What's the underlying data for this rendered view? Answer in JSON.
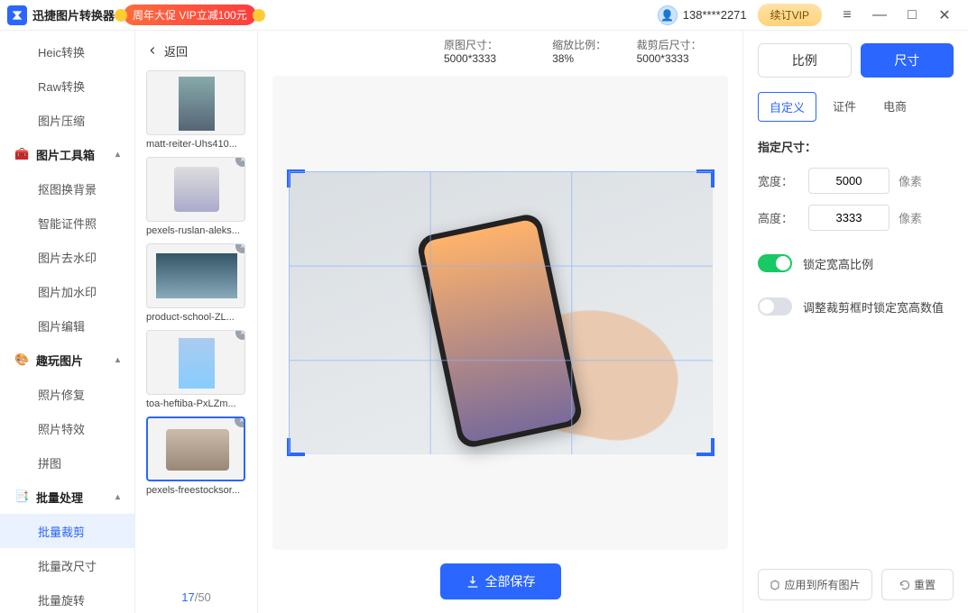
{
  "titlebar": {
    "app_name": "迅捷图片转换器",
    "promo": "周年大促 VIP立减100元",
    "phone": "138****2271",
    "vip_button": "续订VIP"
  },
  "sidebar": {
    "items_top": [
      "Heic转换",
      "Raw转换",
      "图片压缩"
    ],
    "group_toolbox": "图片工具箱",
    "items_toolbox": [
      "抠图换背景",
      "智能证件照",
      "图片去水印",
      "图片加水印",
      "图片编辑"
    ],
    "group_fun": "趣玩图片",
    "items_fun": [
      "照片修复",
      "照片特效",
      "拼图"
    ],
    "group_batch": "批量处理",
    "items_batch": [
      "批量裁剪",
      "批量改尺寸",
      "批量旋转"
    ],
    "active": "批量裁剪"
  },
  "mid": {
    "back": "返回",
    "thumbs": [
      {
        "name": "matt-reiter-Uhs410..."
      },
      {
        "name": "pexels-ruslan-aleks..."
      },
      {
        "name": "product-school-ZL..."
      },
      {
        "name": "toa-heftiba-PxLZm..."
      },
      {
        "name": "pexels-freestocksor..."
      }
    ],
    "counter_cur": "17",
    "counter_sep": "/",
    "counter_tot": "50"
  },
  "canvas": {
    "original_label": "原图尺寸：",
    "original_value": "5000*3333",
    "scale_label": "缩放比例：",
    "scale_value": "38%",
    "crop_label": "裁剪后尺寸：",
    "crop_value": "5000*3333",
    "save_all": "全部保存"
  },
  "right": {
    "mode_ratio": "比例",
    "mode_size": "尺寸",
    "sub_custom": "自定义",
    "sub_id": "证件",
    "sub_ecom": "电商",
    "section_title": "指定尺寸：",
    "width_label": "宽度：",
    "width_value": "5000",
    "height_label": "高度：",
    "height_value": "3333",
    "unit": "像素",
    "lock_ratio": "锁定宽高比例",
    "lock_crop": "调整裁剪框时锁定宽高数值",
    "apply_all": "应用到所有图片",
    "reset": "重置"
  }
}
